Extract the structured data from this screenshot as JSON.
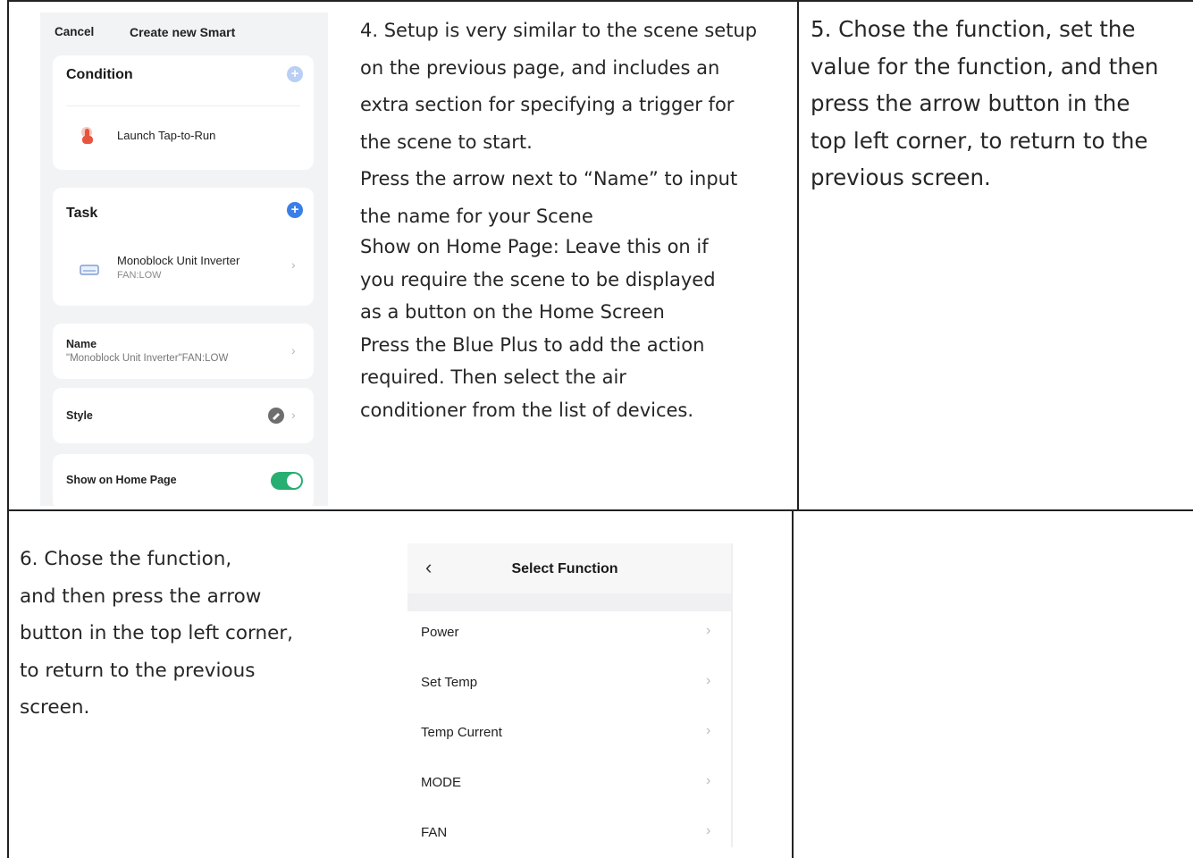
{
  "section4": {
    "paragraph_a": "4. Setup is very similar to the scene setup\non the previous page, and includes an\nextra section for specifying a trigger for\nthe scene to start.\nPress the arrow next to “Name” to input\nthe name for your Scene",
    "paragraph_b": "Show on Home Page: Leave this on if\nyou require the scene to be displayed\nas a button on the Home Screen\nPress the Blue Plus to add the action\nrequired. Then select the air\nconditioner from the list of devices."
  },
  "section5": {
    "text": "5. Chose the function, set the\nvalue for the function, and then\npress the arrow button in the\ntop left corner, to return to the\nprevious screen."
  },
  "section6": {
    "text": "6. Chose the function,\nand then press the arrow\nbutton in the top left corner,\nto return to the previous\nscreen."
  },
  "create_smart_screen": {
    "cancel": "Cancel",
    "title": "Create new Smart",
    "condition_title": "Condition",
    "condition_item": "Launch Tap-to-Run",
    "task_title": "Task",
    "task_device": "Monoblock Unit Inverter",
    "task_value": "FAN:LOW",
    "name_label": "Name",
    "name_value": "\"Monoblock Unit Inverter\"FAN:LOW",
    "style_label": "Style",
    "show_home_label": "Show on Home Page",
    "show_home_on": true,
    "plus": "+",
    "chevron": "›",
    "accent_color": "#3b7ee8",
    "toggle_color": "#27ae71"
  },
  "select_function_screen": {
    "back": "‹",
    "title": "Select Function",
    "chevron": "›",
    "functions": [
      "Power",
      "Set Temp",
      "Temp Current",
      "MODE",
      "FAN"
    ]
  }
}
